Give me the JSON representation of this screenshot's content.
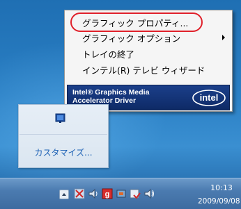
{
  "context_menu": {
    "items": [
      {
        "label": "グラフィック プロパティ...",
        "has_submenu": false
      },
      {
        "label": "グラフィック オプション",
        "has_submenu": true
      },
      {
        "label": "トレイの終了",
        "has_submenu": false
      },
      {
        "label": "インテル(R) テレビ ウィザード",
        "has_submenu": false
      }
    ],
    "banner": {
      "text": "Intel® Graphics Media\nAccelerator Driver",
      "logo_text": "intel"
    },
    "highlight_color": "#e0202a"
  },
  "flyout": {
    "icon": "intel-graphics-tray-icon",
    "customize_label": "カスタマイズ..."
  },
  "taskbar": {
    "tray_icons": [
      "show-hidden-icons-arrow",
      "network-icon",
      "volume-icon",
      "gadget-icon",
      "device-icon",
      "flag-icon",
      "speaker-icon"
    ],
    "clock": {
      "time": "10:13",
      "date": "2009/09/08"
    }
  }
}
